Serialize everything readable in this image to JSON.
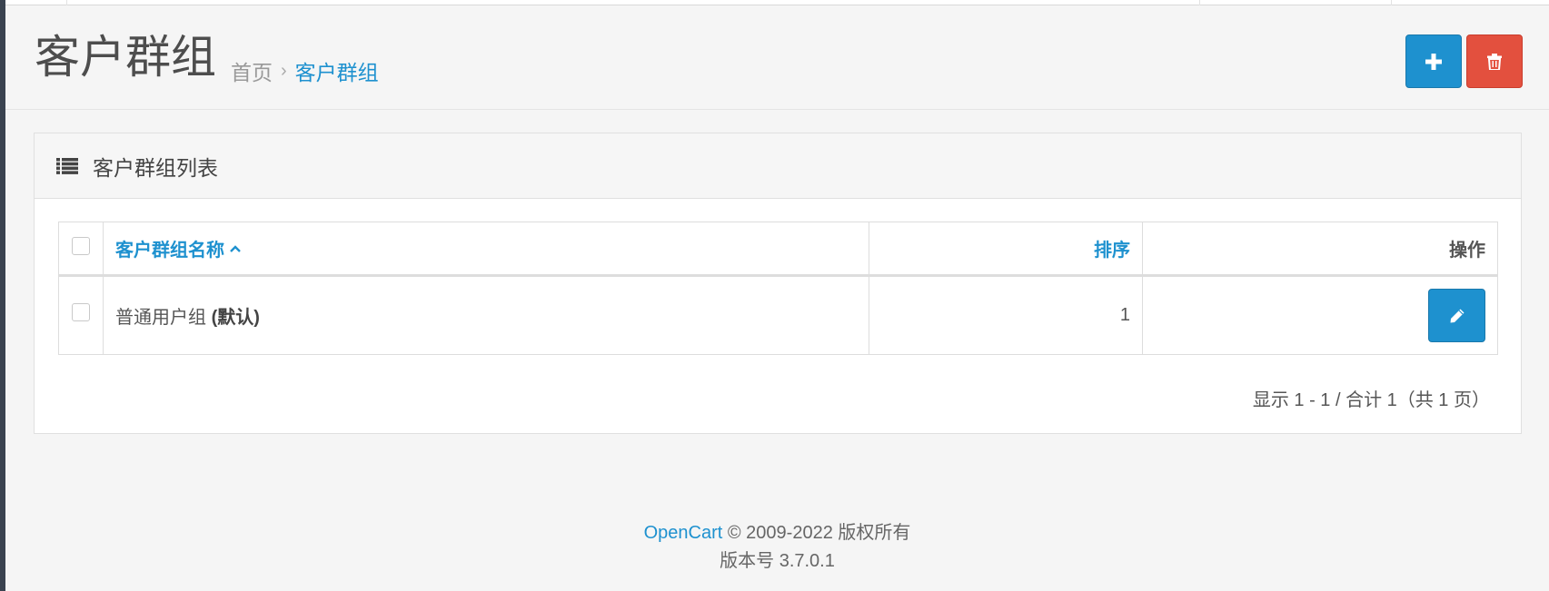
{
  "header": {
    "title": "客户群组",
    "breadcrumb": {
      "home": "首页",
      "separator": "›",
      "current": "客户群组"
    },
    "buttons": {
      "add_icon": "plus-icon",
      "delete_icon": "trash-icon"
    }
  },
  "panel": {
    "title": "客户群组列表",
    "icon": "list-icon",
    "table": {
      "columns": {
        "name": "客户群组名称",
        "sort": "排序",
        "action": "操作"
      },
      "sort_indicator": "caret-up-icon",
      "rows": [
        {
          "name": "普通用户组",
          "default_tag": "(默认)",
          "sort_order": "1",
          "action_icon": "pencil-icon"
        }
      ]
    },
    "pagination_text": "显示 1 - 1 / 合计 1（共 1 页）"
  },
  "footer": {
    "brand": "OpenCart",
    "copyright": "© 2009-2022 版权所有",
    "version": "版本号 3.7.0.1"
  },
  "colors": {
    "primary": "#1e91cf",
    "danger": "#e3503e",
    "background": "#f5f5f5"
  }
}
